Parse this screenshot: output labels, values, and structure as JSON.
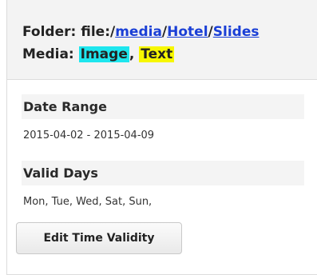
{
  "folder": {
    "label": "Folder:",
    "scheme": "file:/",
    "path": [
      {
        "text": "media"
      },
      {
        "text": "Hotel"
      },
      {
        "text": "Slides"
      }
    ],
    "separator": "/"
  },
  "media": {
    "label": "Media:",
    "types": [
      {
        "text": "Image",
        "color": "#1ee6ee"
      },
      {
        "text": "Text",
        "color": "#f7f700"
      }
    ],
    "separator": ","
  },
  "date_range": {
    "heading": "Date Range",
    "value": "2015-04-02 - 2015-04-09"
  },
  "valid_days": {
    "heading": "Valid Days",
    "value": "Mon, Tue, Wed, Sat, Sun,"
  },
  "actions": {
    "edit_time_validity": "Edit Time Validity"
  },
  "colors": {
    "link": "#1a3fd6",
    "header_bg": "#f3f3f3"
  }
}
